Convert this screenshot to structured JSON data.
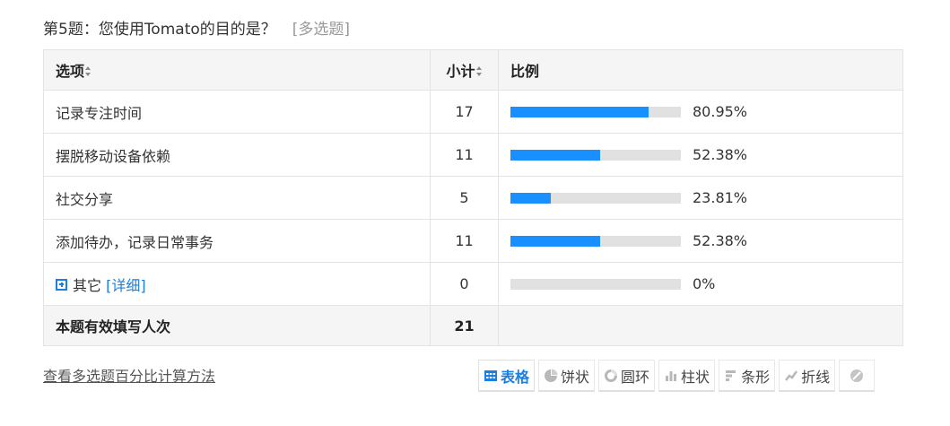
{
  "question": {
    "title": "第5题：您使用Tomato的目的是？",
    "type": "[多选题]"
  },
  "table": {
    "headers": {
      "option": "选项",
      "count": "小计",
      "ratio": "比例"
    },
    "rows": [
      {
        "option": "记录专注时间",
        "count": "17",
        "percent": "80.95%",
        "fraction": 0.8095
      },
      {
        "option": "摆脱移动设备依赖",
        "count": "11",
        "percent": "52.38%",
        "fraction": 0.5238
      },
      {
        "option": "社交分享",
        "count": "5",
        "percent": "23.81%",
        "fraction": 0.2381
      },
      {
        "option": "添加待办，记录日常事务",
        "count": "11",
        "percent": "52.38%",
        "fraction": 0.5238
      }
    ],
    "other": {
      "label": "其它",
      "detail": "[详细]",
      "count": "0",
      "percent": "0%",
      "fraction": 0
    },
    "total": {
      "label": "本题有效填写人次",
      "count": "21"
    }
  },
  "footer": {
    "calc_link": "查看多选题百分比计算方法"
  },
  "chart_tabs": [
    {
      "label": "表格",
      "icon": "table-icon",
      "active": true
    },
    {
      "label": "饼状",
      "icon": "pie-icon",
      "active": false
    },
    {
      "label": "圆环",
      "icon": "ring-icon",
      "active": false
    },
    {
      "label": "柱状",
      "icon": "column-icon",
      "active": false
    },
    {
      "label": "条形",
      "icon": "bar-icon",
      "active": false
    },
    {
      "label": "折线",
      "icon": "line-icon",
      "active": false
    },
    {
      "label": "",
      "icon": "hide-icon",
      "active": false
    }
  ],
  "colors": {
    "bar_fill": "#1890ff",
    "bar_track": "#e1e1e1",
    "link": "#1a7fe0",
    "header_bg": "#f5f5f5"
  }
}
